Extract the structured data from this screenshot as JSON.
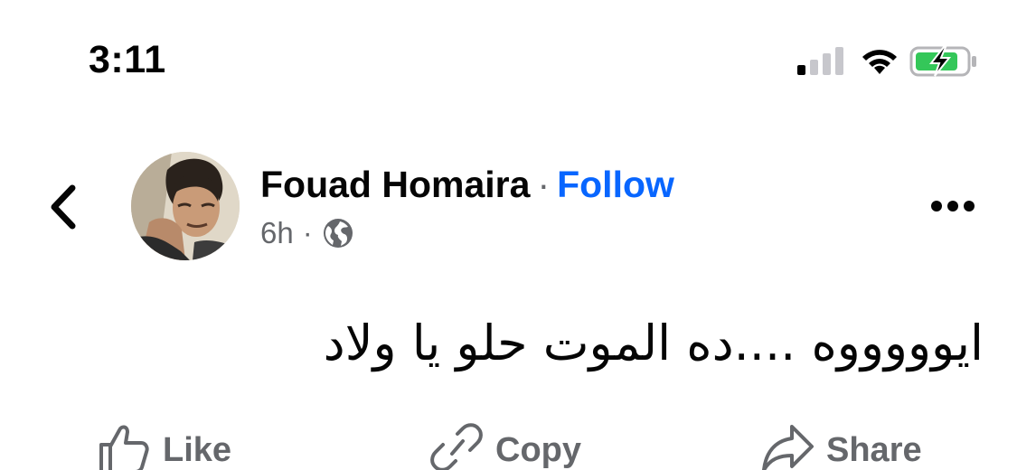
{
  "status_bar": {
    "time": "3:11",
    "signal_icon": "cellular-signal-icon",
    "wifi_icon": "wifi-icon",
    "battery_icon": "battery-charging-icon",
    "battery_color": "#34c759"
  },
  "post": {
    "author": "Fouad Homaira",
    "separator": "·",
    "follow_label": "Follow",
    "time_ago": "6h",
    "meta_separator": "·",
    "audience_icon": "globe-icon",
    "text": "ايوووووه ....ده الموت حلو يا ولاد"
  },
  "actions": [
    {
      "label": "Like",
      "icon": "thumbs-up-icon"
    },
    {
      "label": "Copy",
      "icon": "link-icon"
    },
    {
      "label": "Share",
      "icon": "share-arrow-icon"
    }
  ],
  "colors": {
    "link_blue": "#0866ff",
    "secondary_text": "#65676b",
    "primary_text": "#050505"
  }
}
